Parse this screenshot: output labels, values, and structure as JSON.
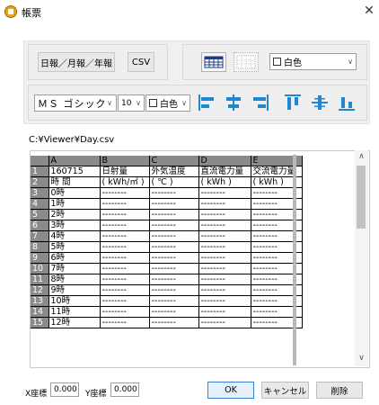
{
  "window": {
    "title": "帳票",
    "close_glyph": "✕"
  },
  "toolbar": {
    "period_button": "日報／月報／年報",
    "csv_button": "CSV",
    "bg_color_label": "白色",
    "font_name": "ＭＳ ゴシック",
    "font_size": "10",
    "text_color_label": "白色"
  },
  "file_path": "C:¥Viewer¥Day.csv",
  "sheet": {
    "columns": [
      "A",
      "B",
      "C",
      "D",
      "E"
    ],
    "rows": [
      {
        "n": "1",
        "cells": [
          "160715",
          "日射量",
          "外気温度",
          "直流電力量",
          "交流電力量"
        ]
      },
      {
        "n": "2",
        "cells": [
          "時 間",
          "( kWh/㎡ )",
          "( ℃ )",
          "( kWh )",
          "( kWh )"
        ]
      },
      {
        "n": "3",
        "cells": [
          "0時",
          "--------",
          "--------",
          "--------",
          "--------"
        ]
      },
      {
        "n": "4",
        "cells": [
          "1時",
          "--------",
          "--------",
          "--------",
          "--------"
        ]
      },
      {
        "n": "5",
        "cells": [
          "2時",
          "--------",
          "--------",
          "--------",
          "--------"
        ]
      },
      {
        "n": "6",
        "cells": [
          "3時",
          "--------",
          "--------",
          "--------",
          "--------"
        ]
      },
      {
        "n": "7",
        "cells": [
          "4時",
          "--------",
          "--------",
          "--------",
          "--------"
        ]
      },
      {
        "n": "8",
        "cells": [
          "5時",
          "--------",
          "--------",
          "--------",
          "--------"
        ]
      },
      {
        "n": "9",
        "cells": [
          "6時",
          "--------",
          "--------",
          "--------",
          "--------"
        ]
      },
      {
        "n": "10",
        "cells": [
          "7時",
          "--------",
          "--------",
          "--------",
          "--------"
        ]
      },
      {
        "n": "11",
        "cells": [
          "8時",
          "--------",
          "--------",
          "--------",
          "--------"
        ]
      },
      {
        "n": "12",
        "cells": [
          "9時",
          "--------",
          "--------",
          "--------",
          "--------"
        ]
      },
      {
        "n": "13",
        "cells": [
          "10時",
          "--------",
          "--------",
          "--------",
          "--------"
        ]
      },
      {
        "n": "14",
        "cells": [
          "11時",
          "--------",
          "--------",
          "--------",
          "--------"
        ]
      },
      {
        "n": "15",
        "cells": [
          "12時",
          "--------",
          "--------",
          "--------",
          "--------"
        ]
      }
    ]
  },
  "footer": {
    "x_label": "X座標",
    "x_value": "0.000",
    "y_label": "Y座標",
    "y_value": "0.000",
    "ok": "OK",
    "cancel": "キャンセル",
    "delete": "削除"
  },
  "icons": {
    "align_color": "#1e88d2",
    "app_icon": "report-app-icon"
  }
}
